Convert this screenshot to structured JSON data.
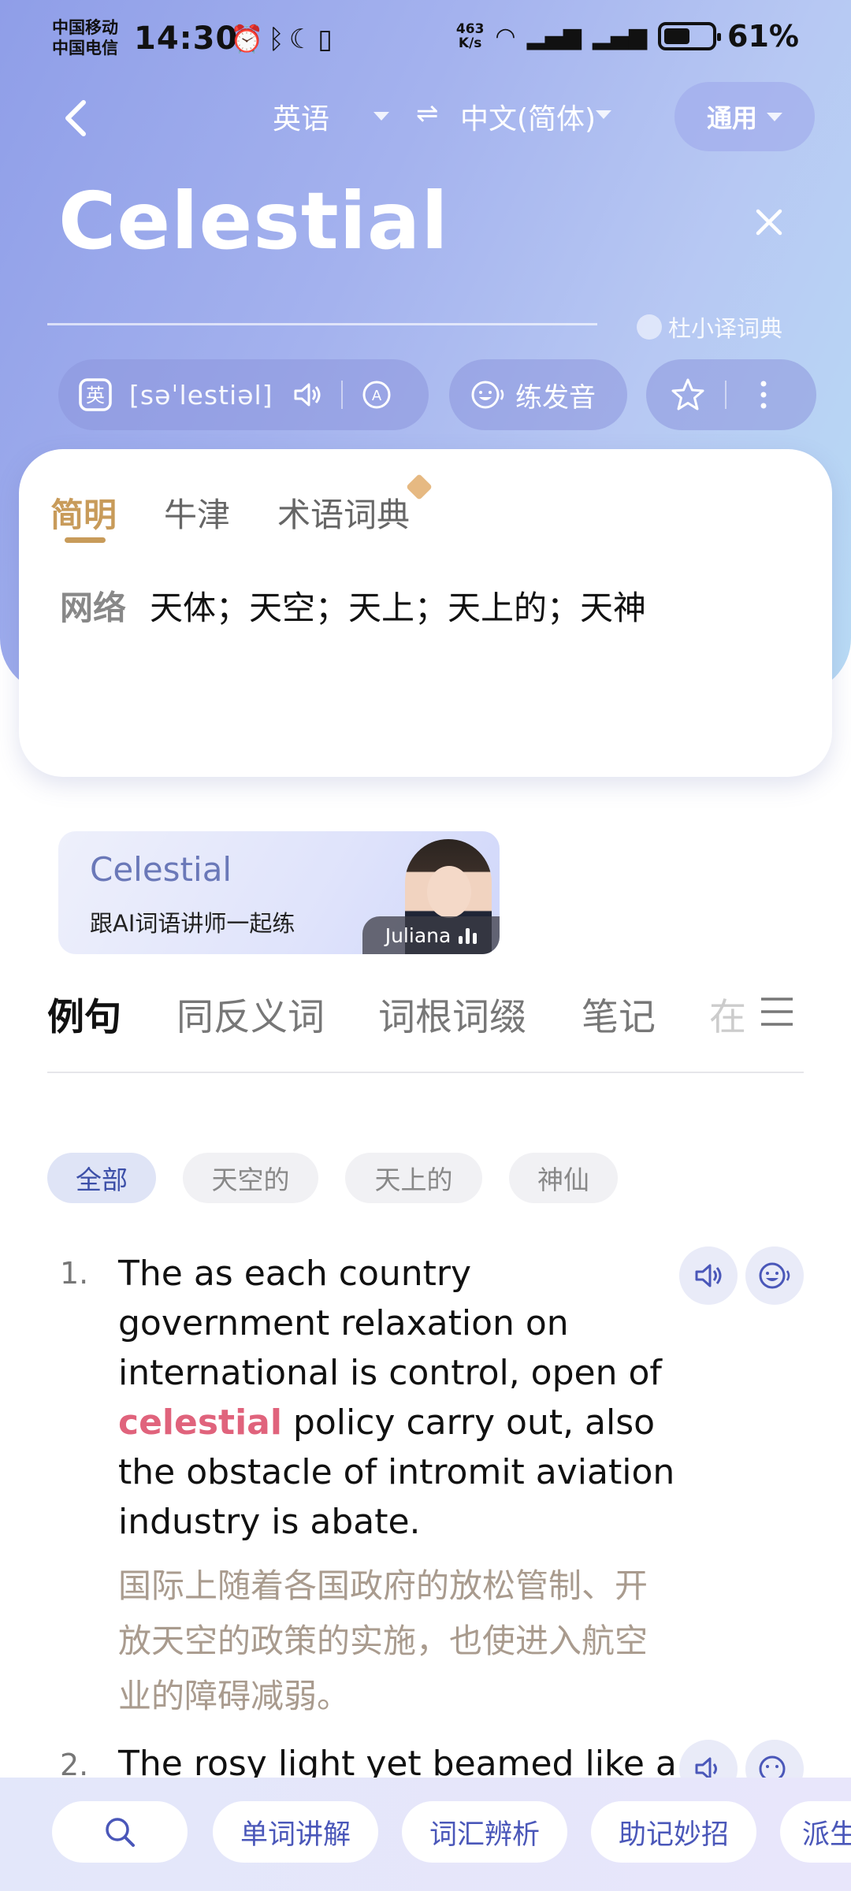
{
  "status_bar": {
    "carrier1": "中国移动",
    "carrier2": "中国电信",
    "time": "14:30",
    "net_speed_top": "463",
    "net_speed_bottom": "K/s",
    "battery": "61%"
  },
  "topbar": {
    "lang_from": "英语",
    "lang_to": "中文(简体)",
    "mode": "通用"
  },
  "search": {
    "headword": "Celestial",
    "dict_source": "杜小译词典"
  },
  "pron": {
    "phonetic": "[səˈlestiəl]",
    "practice_label": "练发音"
  },
  "dict_tabs": [
    "简明",
    "牛津",
    "术语词典"
  ],
  "definition": {
    "label": "网络",
    "text": "天体；天空；天上；天上的；天神"
  },
  "banner": {
    "title": "Celestial",
    "subtitle": "跟AI词语讲师一起练",
    "tutor": "Juliana"
  },
  "section_tabs": [
    "例句",
    "同反义词",
    "词根词缀",
    "笔记",
    "在"
  ],
  "chips": [
    "全部",
    "天空的",
    "天上的",
    "神仙"
  ],
  "examples": [
    {
      "num": "1.",
      "en_before": "The as each country government relaxation on international is control, open of ",
      "en_highlight": "celestial",
      "en_after": " policy carry out, also the obstacle of intromit aviation industry is abate.",
      "cn": "国际上随着各国政府的放松管制、开放天空的政策的实施，也使进入航空业的障碍减弱。"
    },
    {
      "num": "2.",
      "en_before": "The rosy light yet beamed like a",
      "en_highlight": "",
      "en_after": "",
      "cn": ""
    }
  ],
  "bottom_bar": [
    "单词讲解",
    "词汇辨析",
    "助记妙招",
    "派生"
  ],
  "colors": {
    "accent_gold": "#c89b5a",
    "highlight_pink": "#e0637c",
    "bottom_link": "#4a57b9"
  },
  "icons": [
    "back-arrow-icon",
    "swap-icon",
    "close-icon",
    "translate-icon",
    "speaker-icon",
    "auto-play-icon",
    "smile-voice-icon",
    "star-icon",
    "more-icon",
    "menu-icon",
    "search-icon"
  ]
}
